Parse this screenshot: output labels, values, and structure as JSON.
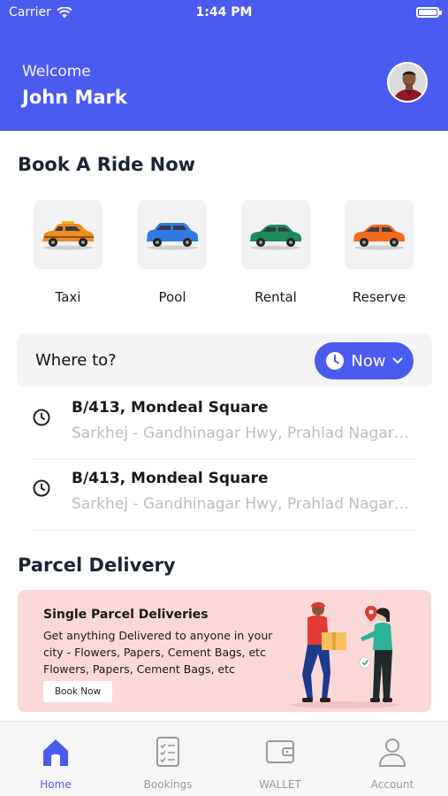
{
  "status_bar": {
    "carrier": "Carrier",
    "time": "1:44 PM"
  },
  "header": {
    "welcome": "Welcome",
    "user_name": "John Mark"
  },
  "book_ride": {
    "title": "Book A Ride Now",
    "options": [
      {
        "label": "Taxi",
        "icon": "taxi-car-icon",
        "color": "#f08a1c"
      },
      {
        "label": "Pool",
        "icon": "pool-car-icon",
        "color": "#2f7be0"
      },
      {
        "label": "Rental",
        "icon": "rental-car-icon",
        "color": "#1c8a5c"
      },
      {
        "label": "Reserve",
        "icon": "reserve-car-icon",
        "color": "#f26a1c"
      }
    ]
  },
  "where_to": {
    "label": "Where to?",
    "time_option": "Now"
  },
  "recent_places": [
    {
      "title": "B/413, Mondeal Square",
      "address": "Sarkhej - Gandhinagar Hwy, Prahlad Nagar, Ahmedabad"
    },
    {
      "title": "B/413, Mondeal Square",
      "address": "Sarkhej - Gandhinagar Hwy, Prahlad Nagar, Ahmedabad"
    }
  ],
  "parcel": {
    "section_title": "Parcel Delivery",
    "card_title": "Single Parcel Deliveries",
    "card_description": "Get anything Delivered to anyone in your city - Flowers, Papers, Cement Bags, etc Flowers, Papers, Cement Bags, etc",
    "button": "Book Now"
  },
  "tabs": [
    {
      "label": "Home",
      "icon": "home-icon",
      "active": true
    },
    {
      "label": "Bookings",
      "icon": "bookings-icon",
      "active": false
    },
    {
      "label": "WALLET",
      "icon": "wallet-icon",
      "active": false
    },
    {
      "label": "Account",
      "icon": "account-icon",
      "active": false
    }
  ],
  "colors": {
    "primary": "#4a5bf0",
    "card_pink": "#fbd8d8",
    "muted_text": "#bdbdbd"
  }
}
